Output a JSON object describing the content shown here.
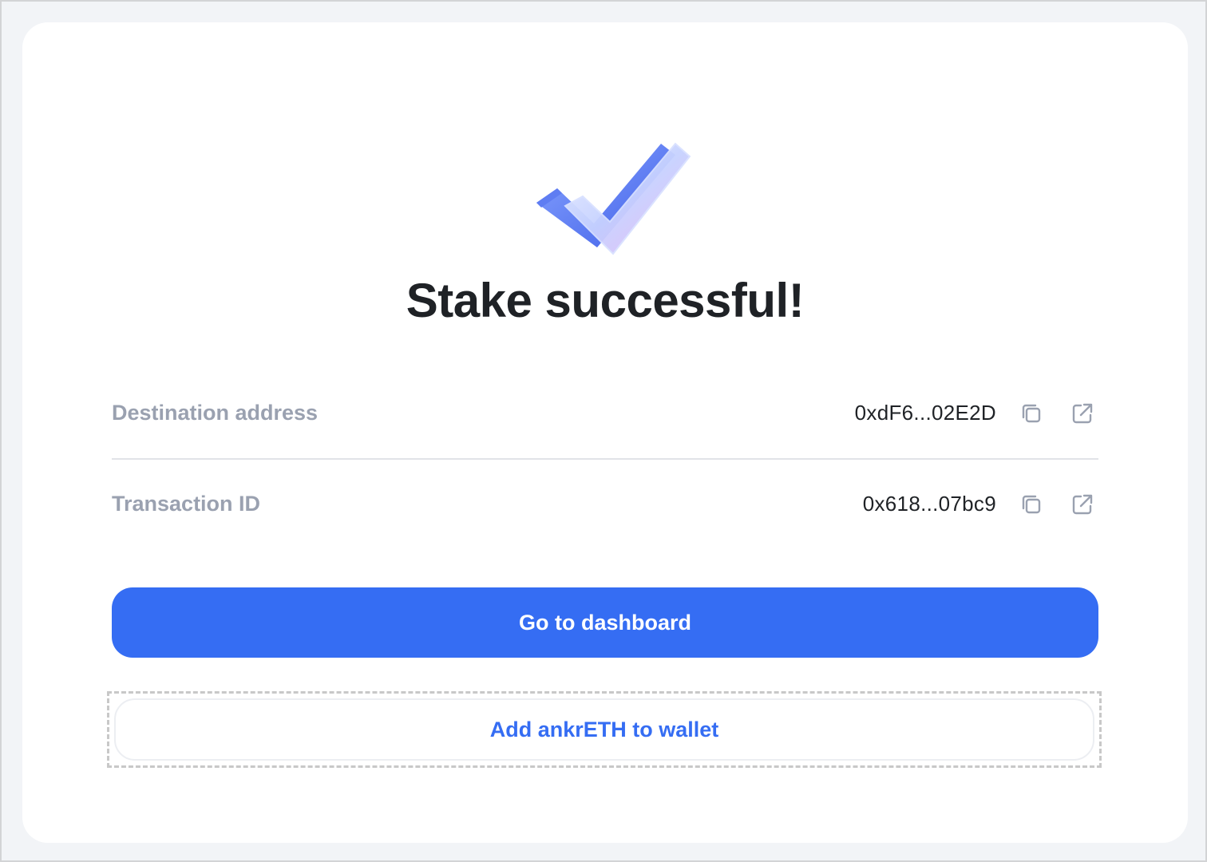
{
  "title": "Stake successful!",
  "illustration": "checkmark-3d-icon",
  "details": [
    {
      "label": "Destination address",
      "value": "0xdF6...02E2D",
      "copy_icon": "copy-icon",
      "link_icon": "external-link-icon"
    },
    {
      "label": "Transaction ID",
      "value": "0x618...07bc9",
      "copy_icon": "copy-icon",
      "link_icon": "external-link-icon"
    }
  ],
  "actions": {
    "primary_label": "Go to dashboard",
    "secondary_label": "Add ankrETH to wallet"
  },
  "colors": {
    "accent": "#356df3",
    "label": "#9aa1b0",
    "text": "#1f2226",
    "page_background": "#f2f4f7",
    "card_background": "#ffffff"
  }
}
